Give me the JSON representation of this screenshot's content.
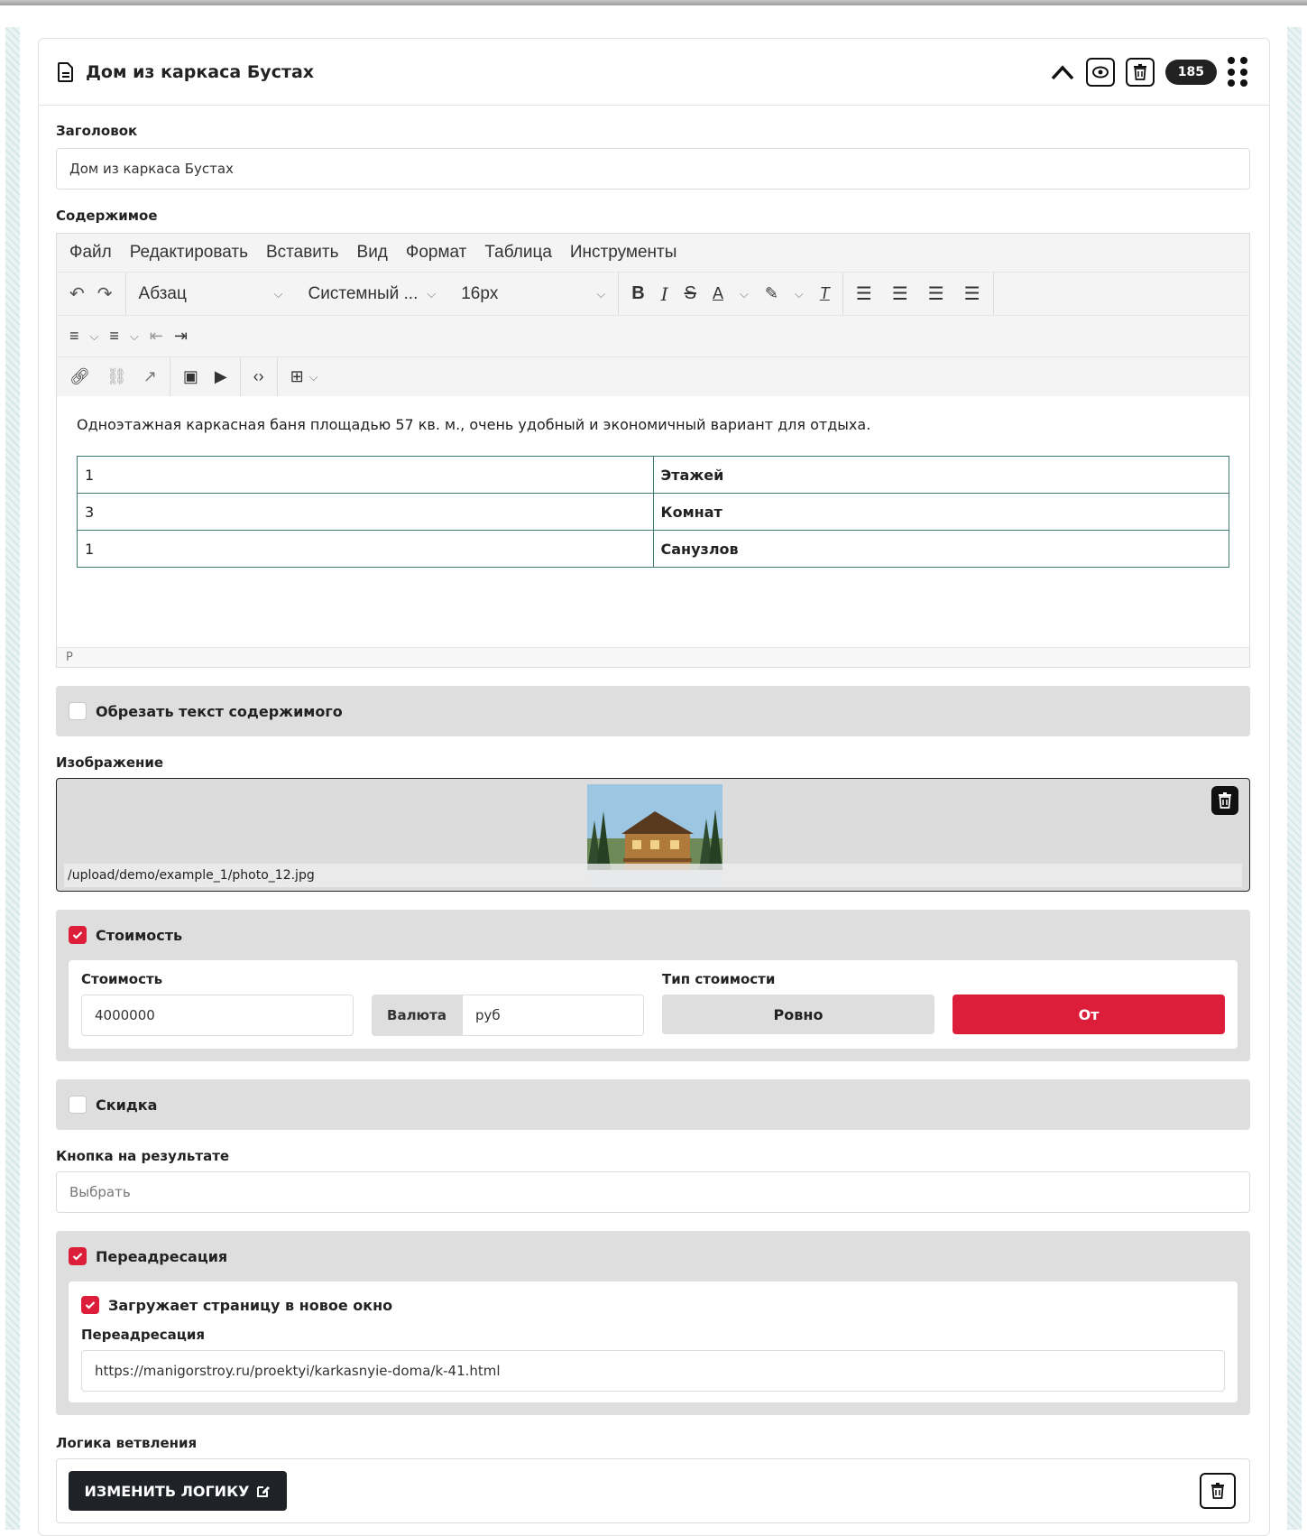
{
  "header": {
    "title": "Дом из каркаса Бустах",
    "count": "185"
  },
  "fields": {
    "title_label": "Заголовок",
    "title_value": "Дом из каркаса Бустах",
    "content_label": "Содержимое"
  },
  "editor": {
    "menu": [
      "Файл",
      "Редактировать",
      "Вставить",
      "Вид",
      "Формат",
      "Таблица",
      "Инструменты"
    ],
    "block_format": "Абзац",
    "font_family": "Системный ...",
    "font_size": "16px",
    "paragraph": "Одноэтажная каркасная баня площадью 57 кв. м., очень удобный и экономичный вариант для отдыха.",
    "table": [
      [
        "1",
        "Этажей"
      ],
      [
        "3",
        "Комнат"
      ],
      [
        "1",
        "Санузлов"
      ]
    ],
    "status_path": "P"
  },
  "trim": {
    "label": "Обрезать текст содержимого",
    "checked": false
  },
  "image": {
    "label": "Изображение",
    "path": "/upload/demo/example_1/photo_12.jpg"
  },
  "price": {
    "toggle_label": "Стоимость",
    "checked": true,
    "cost_label": "Стоимость",
    "cost_value": "4000000",
    "currency_label": "Валюта",
    "currency_value": "руб",
    "type_label": "Тип стоимости",
    "type_exact": "Ровно",
    "type_from": "От",
    "selected_type": "От"
  },
  "discount": {
    "label": "Скидка",
    "checked": false
  },
  "result_button": {
    "label": "Кнопка на результате",
    "placeholder": "Выбрать"
  },
  "redirect": {
    "toggle_label": "Переадресация",
    "checked": true,
    "new_window_label": "Загружает страницу в новое окно",
    "new_window_checked": true,
    "url_label": "Переадресация",
    "url_value": "https://manigorstroy.ru/proektyi/karkasnyie-doma/k-41.html"
  },
  "logic": {
    "label": "Логика ветвления",
    "button": "ИЗМЕНИТЬ ЛОГИКУ"
  },
  "colors": {
    "accent": "#dc1e3a",
    "dark": "#1f2328",
    "panel": "#dedede"
  }
}
